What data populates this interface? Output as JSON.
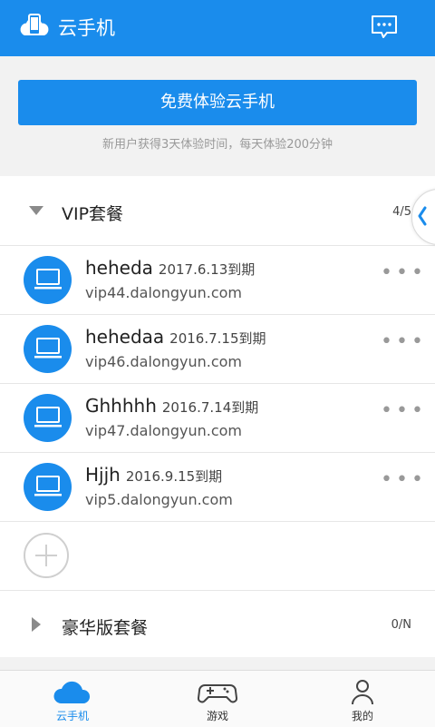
{
  "header": {
    "title": "云手机"
  },
  "trial": {
    "button_label": "免费体验云手机",
    "hint": "新用户获得3天体验时间，每天体验200分钟"
  },
  "groups": [
    {
      "name": "VIP套餐",
      "count": "4/5",
      "expanded": true
    },
    {
      "name": "豪华版套餐",
      "count": "0/N",
      "expanded": false
    }
  ],
  "devices": [
    {
      "name": "heheda",
      "expiry": "2017.6.13到期",
      "host": "vip44.dalongyun.com"
    },
    {
      "name": "hehedaa",
      "expiry": "2016.7.15到期",
      "host": "vip46.dalongyun.com"
    },
    {
      "name": "Ghhhhh",
      "expiry": "2016.7.14到期",
      "host": "vip47.dalongyun.com"
    },
    {
      "name": "Hjjh",
      "expiry": "2016.9.15到期",
      "host": "vip5.dalongyun.com"
    }
  ],
  "more_glyph": "•••",
  "tabs": [
    {
      "label": "云手机",
      "icon": "cloud-icon",
      "active": true
    },
    {
      "label": "游戏",
      "icon": "gamepad-icon",
      "active": false
    },
    {
      "label": "我的",
      "icon": "user-icon",
      "active": false
    }
  ],
  "colors": {
    "primary": "#1a8cec",
    "background": "#f2f2f2"
  }
}
